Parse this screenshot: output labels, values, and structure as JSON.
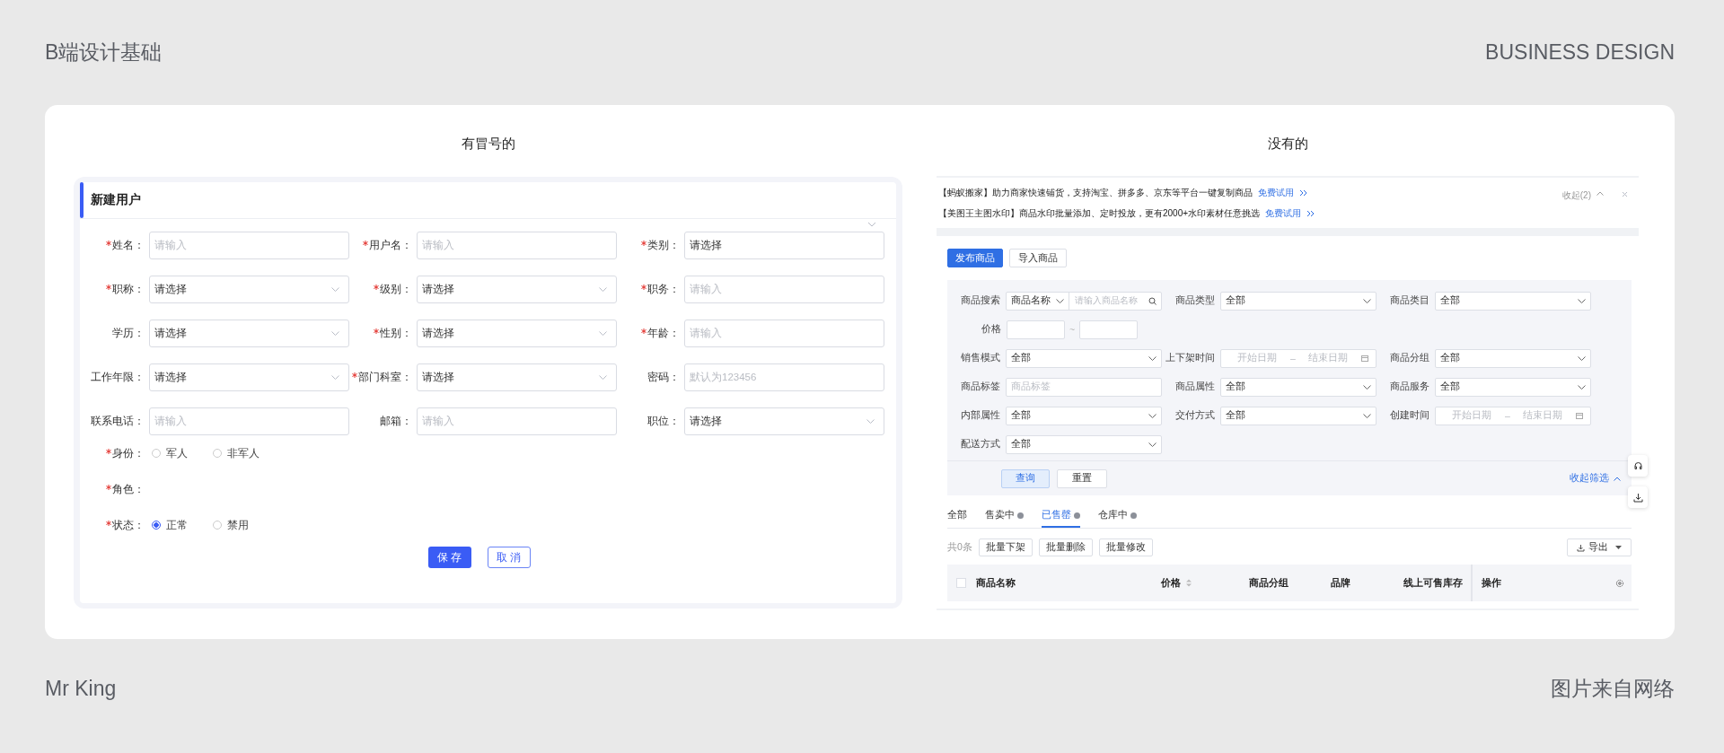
{
  "header": {
    "title": "B端设计基础",
    "brand": "BUSINESS DESIGN"
  },
  "captions": [
    "有冒号的",
    "没有的"
  ],
  "user_form": {
    "title": "新建用户",
    "fields": [
      {
        "label": "姓名：",
        "required": true,
        "kind": "input",
        "placeholder": "请输入"
      },
      {
        "label": "用户名：",
        "required": true,
        "kind": "input",
        "placeholder": "请输入"
      },
      {
        "label": "类别：",
        "required": true,
        "kind": "input",
        "value": "请选择"
      },
      {
        "label": "职称：",
        "required": true,
        "kind": "select",
        "value": "请选择"
      },
      {
        "label": "级别：",
        "required": true,
        "kind": "select",
        "value": "请选择"
      },
      {
        "label": "职务：",
        "required": true,
        "kind": "input",
        "placeholder": "请输入"
      },
      {
        "label": "学历：",
        "required": false,
        "kind": "select",
        "value": "请选择"
      },
      {
        "label": "性别：",
        "required": true,
        "kind": "select",
        "value": "请选择"
      },
      {
        "label": "年龄：",
        "required": true,
        "kind": "input",
        "placeholder": "请输入"
      },
      {
        "label": "工作年限：",
        "required": false,
        "kind": "select",
        "value": "请选择"
      },
      {
        "label": "部门科室：",
        "required": true,
        "kind": "select",
        "value": "请选择"
      },
      {
        "label": "密码：",
        "required": false,
        "kind": "input",
        "placeholder": "默认为123456"
      },
      {
        "label": "联系电话：",
        "required": false,
        "kind": "input",
        "placeholder": "请输入"
      },
      {
        "label": "邮箱：",
        "required": false,
        "kind": "input",
        "placeholder": "请输入"
      },
      {
        "label": "职位：",
        "required": false,
        "kind": "select",
        "value": "请选择"
      }
    ],
    "choices": [
      {
        "label": "身份：",
        "required": true,
        "options": [
          {
            "label": "军人",
            "selected": false
          },
          {
            "label": "非军人",
            "selected": false
          }
        ]
      },
      {
        "label": "角色：",
        "required": true
      },
      {
        "label": "状态：",
        "required": true,
        "options": [
          {
            "label": "正常",
            "selected": true
          },
          {
            "label": "禁用",
            "selected": false
          }
        ]
      }
    ],
    "buttons": [
      {
        "label": "保 存",
        "kind": "primary"
      },
      {
        "label": "取 消",
        "kind": "outline"
      }
    ]
  },
  "goods_page": {
    "notices": [
      {
        "source": "【蚂蚁搬家】",
        "text": "助力商家快速铺货，支持淘宝、拼多多、京东等平台一键复制商品",
        "link": "免费试用"
      },
      {
        "source": "【美图王主图水印】",
        "text": "商品水印批量添加、定时投放，更有2000+水印素材任意挑选",
        "link": "免费试用"
      }
    ],
    "notice_toggle": "收起(2)",
    "actions": [
      {
        "label": "发布商品",
        "kind": "primary"
      },
      {
        "label": "导入商品",
        "kind": "default"
      }
    ],
    "filters": [
      [
        {
          "label": "商品搜索",
          "kind": "search",
          "value": "商品名称",
          "placeholder": "请输入商品名称"
        },
        {
          "label": "商品类型",
          "kind": "select",
          "value": "全部"
        },
        {
          "label": "商品类目",
          "kind": "select",
          "value": "全部"
        }
      ],
      [
        {
          "label": "价格",
          "kind": "range",
          "separator": "~"
        }
      ],
      [
        {
          "label": "销售模式",
          "kind": "select",
          "value": "全部"
        },
        {
          "label": "上下架时间",
          "kind": "date",
          "start": "开始日期",
          "end": "结束日期",
          "separator": "–"
        },
        {
          "label": "商品分组",
          "kind": "select",
          "value": "全部"
        }
      ],
      [
        {
          "label": "商品标签",
          "kind": "input",
          "placeholder": "商品标签"
        },
        {
          "label": "商品属性",
          "kind": "select",
          "value": "全部"
        },
        {
          "label": "商品服务",
          "kind": "select",
          "value": "全部"
        }
      ],
      [
        {
          "label": "内部属性",
          "kind": "select",
          "value": "全部"
        },
        {
          "label": "交付方式",
          "kind": "select",
          "value": "全部"
        },
        {
          "label": "创建时间",
          "kind": "date",
          "start": "开始日期",
          "end": "结束日期",
          "separator": "–"
        }
      ],
      [
        {
          "label": "配送方式",
          "kind": "select",
          "value": "全部"
        }
      ]
    ],
    "filter_buttons": [
      {
        "label": "查询",
        "kind": "primary"
      },
      {
        "label": "重置",
        "kind": "default"
      }
    ],
    "filter_toggle": "收起筛选",
    "tabs": [
      {
        "label": "全部",
        "selected": false,
        "help": false
      },
      {
        "label": "售卖中",
        "selected": false,
        "help": true
      },
      {
        "label": "已售罄",
        "selected": true,
        "help": true
      },
      {
        "label": "仓库中",
        "selected": false,
        "help": true
      }
    ],
    "count": "共0条",
    "batch_buttons": [
      "批量下架",
      "批量删除",
      "批量修改"
    ],
    "export": "导出",
    "select_all": {
      "checked": false
    },
    "columns": [
      {
        "label": "商品名称",
        "sortable": false
      },
      {
        "label": "价格",
        "sortable": true
      },
      {
        "label": "商品分组",
        "sortable": false
      },
      {
        "label": "品牌",
        "sortable": false
      },
      {
        "label": "线上可售库存",
        "sortable": false
      },
      {
        "label": "操作",
        "sortable": false
      }
    ]
  },
  "footer": {
    "author": "Mr King",
    "source": "图片来自网络"
  }
}
